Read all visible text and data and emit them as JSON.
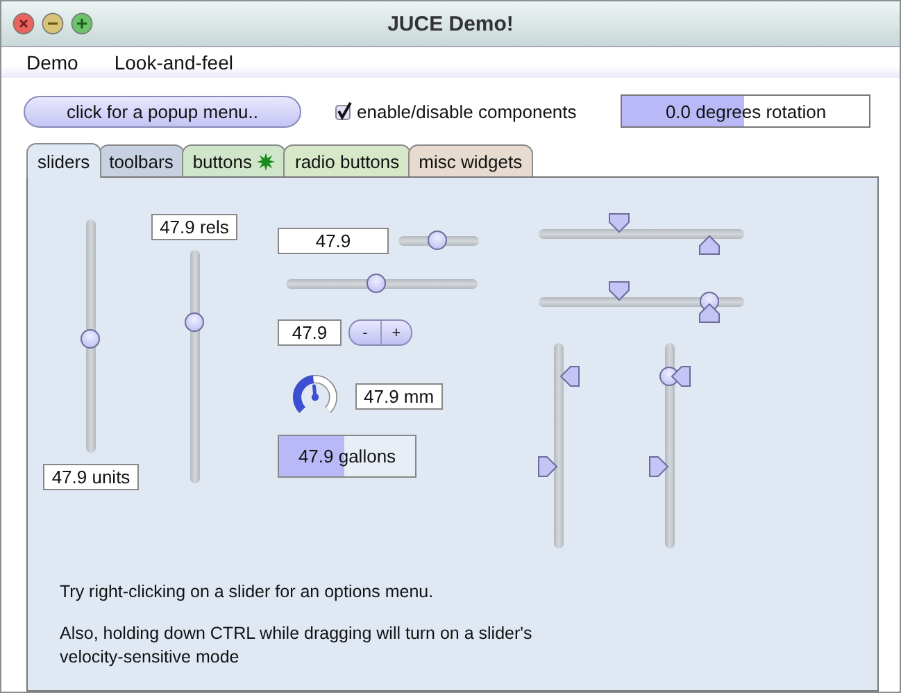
{
  "window": {
    "title": "JUCE Demo!"
  },
  "menu": [
    "Demo",
    "Look-and-feel"
  ],
  "toolbar": {
    "popup_button": "click for a popup menu..",
    "checkbox": {
      "label": "enable/disable components",
      "checked": true
    },
    "rotation": {
      "text": "0.0 degrees rotation",
      "level": 0.49
    }
  },
  "tabs": [
    {
      "label": "sliders",
      "selected": true,
      "badge": false,
      "color": "#dfe8f3"
    },
    {
      "label": "toolbars",
      "selected": false,
      "badge": false,
      "color": "#c7d1e2"
    },
    {
      "label": "buttons",
      "selected": false,
      "badge": true,
      "color": "#cfe6cb"
    },
    {
      "label": "radio buttons",
      "selected": false,
      "badge": false,
      "color": "#d7e8c9"
    },
    {
      "label": "misc widgets",
      "selected": false,
      "badge": false,
      "color": "#e7dbcf"
    }
  ],
  "panel": {
    "vertical_sliders": [
      {
        "readout": "47.9 units",
        "level": 0.49
      },
      {
        "readout": "47.9 rels",
        "level": 0.69
      }
    ],
    "text_slider": {
      "value": "47.9",
      "level": 0.48
    },
    "linear_slider": {
      "level": 0.47
    },
    "inc_dec": {
      "value": "47.9",
      "minus": "-",
      "plus": "+"
    },
    "rotary": {
      "readout": "47.9 mm"
    },
    "bar": {
      "readout": "47.9 gallons",
      "level": 0.48
    },
    "range_sliders": [
      {
        "kind": "twovalue"
      },
      {
        "kind": "threevalue",
        "level": 0.83
      },
      {
        "kind": "twovalue"
      },
      {
        "kind": "threevalue",
        "level": 0.84
      }
    ],
    "notes": [
      "Try right-clicking on a slider for an options menu.",
      "Also, holding down CTRL while dragging will turn on a slider's velocity-sensitive mode"
    ]
  }
}
